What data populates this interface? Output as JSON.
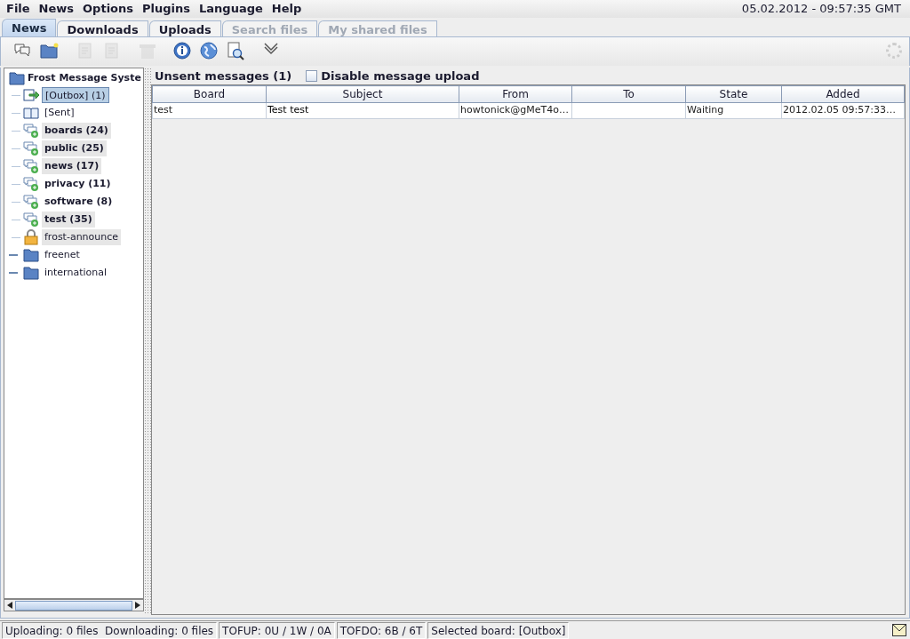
{
  "menu": [
    "File",
    "News",
    "Options",
    "Plugins",
    "Language",
    "Help"
  ],
  "clock": "05.02.2012 - 09:57:35 GMT",
  "tabs": [
    {
      "label": "News",
      "selected": true,
      "disabled": false
    },
    {
      "label": "Downloads",
      "selected": false,
      "disabled": false
    },
    {
      "label": "Uploads",
      "selected": false,
      "disabled": false
    },
    {
      "label": "Search files",
      "selected": false,
      "disabled": true
    },
    {
      "label": "My shared files",
      "selected": false,
      "disabled": true
    }
  ],
  "toolbar": [
    {
      "kind": "chat",
      "disabled": false
    },
    {
      "kind": "folder",
      "disabled": false
    },
    {
      "kind": "sep"
    },
    {
      "kind": "doc",
      "disabled": true
    },
    {
      "kind": "doc",
      "disabled": true
    },
    {
      "kind": "sep"
    },
    {
      "kind": "trash",
      "disabled": true
    },
    {
      "kind": "sep"
    },
    {
      "kind": "info",
      "disabled": false
    },
    {
      "kind": "globe",
      "disabled": false
    },
    {
      "kind": "search",
      "disabled": false
    },
    {
      "kind": "sep"
    },
    {
      "kind": "chevron",
      "disabled": false
    }
  ],
  "tree": {
    "label": "Frost Message Syste",
    "children": [
      {
        "kind": "outbox",
        "label": "[Outbox] (1)",
        "selected": true,
        "bold": false
      },
      {
        "kind": "sent",
        "label": "[Sent]",
        "selected": false,
        "bold": false,
        "highlighted": false
      },
      {
        "kind": "board",
        "label": "boards (24)",
        "selected": false,
        "bold": true,
        "highlighted": true
      },
      {
        "kind": "board",
        "label": "public (25)",
        "selected": false,
        "bold": true,
        "highlighted": true
      },
      {
        "kind": "board",
        "label": "news (17)",
        "selected": false,
        "bold": true,
        "highlighted": true
      },
      {
        "kind": "board",
        "label": "privacy (11)",
        "selected": false,
        "bold": true,
        "highlighted": false
      },
      {
        "kind": "board",
        "label": "software (8)",
        "selected": false,
        "bold": true,
        "highlighted": false
      },
      {
        "kind": "board",
        "label": "test (35)",
        "selected": false,
        "bold": true,
        "highlighted": true
      },
      {
        "kind": "locked",
        "label": "frost-announce",
        "selected": false,
        "bold": false,
        "highlighted": true
      },
      {
        "kind": "folder",
        "label": "freenet",
        "selected": false,
        "bold": false,
        "highlighted": false,
        "expanded": false
      },
      {
        "kind": "folder",
        "label": "international",
        "selected": false,
        "bold": false,
        "highlighted": false,
        "expanded": false
      }
    ]
  },
  "panel": {
    "title": "Unsent messages (1)",
    "disable_upload": {
      "label": "Disable message upload",
      "checked": false
    }
  },
  "table": {
    "columns": [
      "Board",
      "Subject",
      "From",
      "To",
      "State",
      "Added"
    ],
    "rows": [
      {
        "cells": [
          "test",
          "Test test",
          "howtonick@gMeT4o…",
          "",
          "Waiting",
          "2012.02.05 09:57:33…"
        ],
        "selected": false
      }
    ]
  },
  "status_bar": [
    "Uploading: 0 files  Downloading: 0 files",
    "TOFUP: 0U / 1W / 0A",
    "TOFDO: 6B / 6T",
    "Selected board: [Outbox]"
  ]
}
